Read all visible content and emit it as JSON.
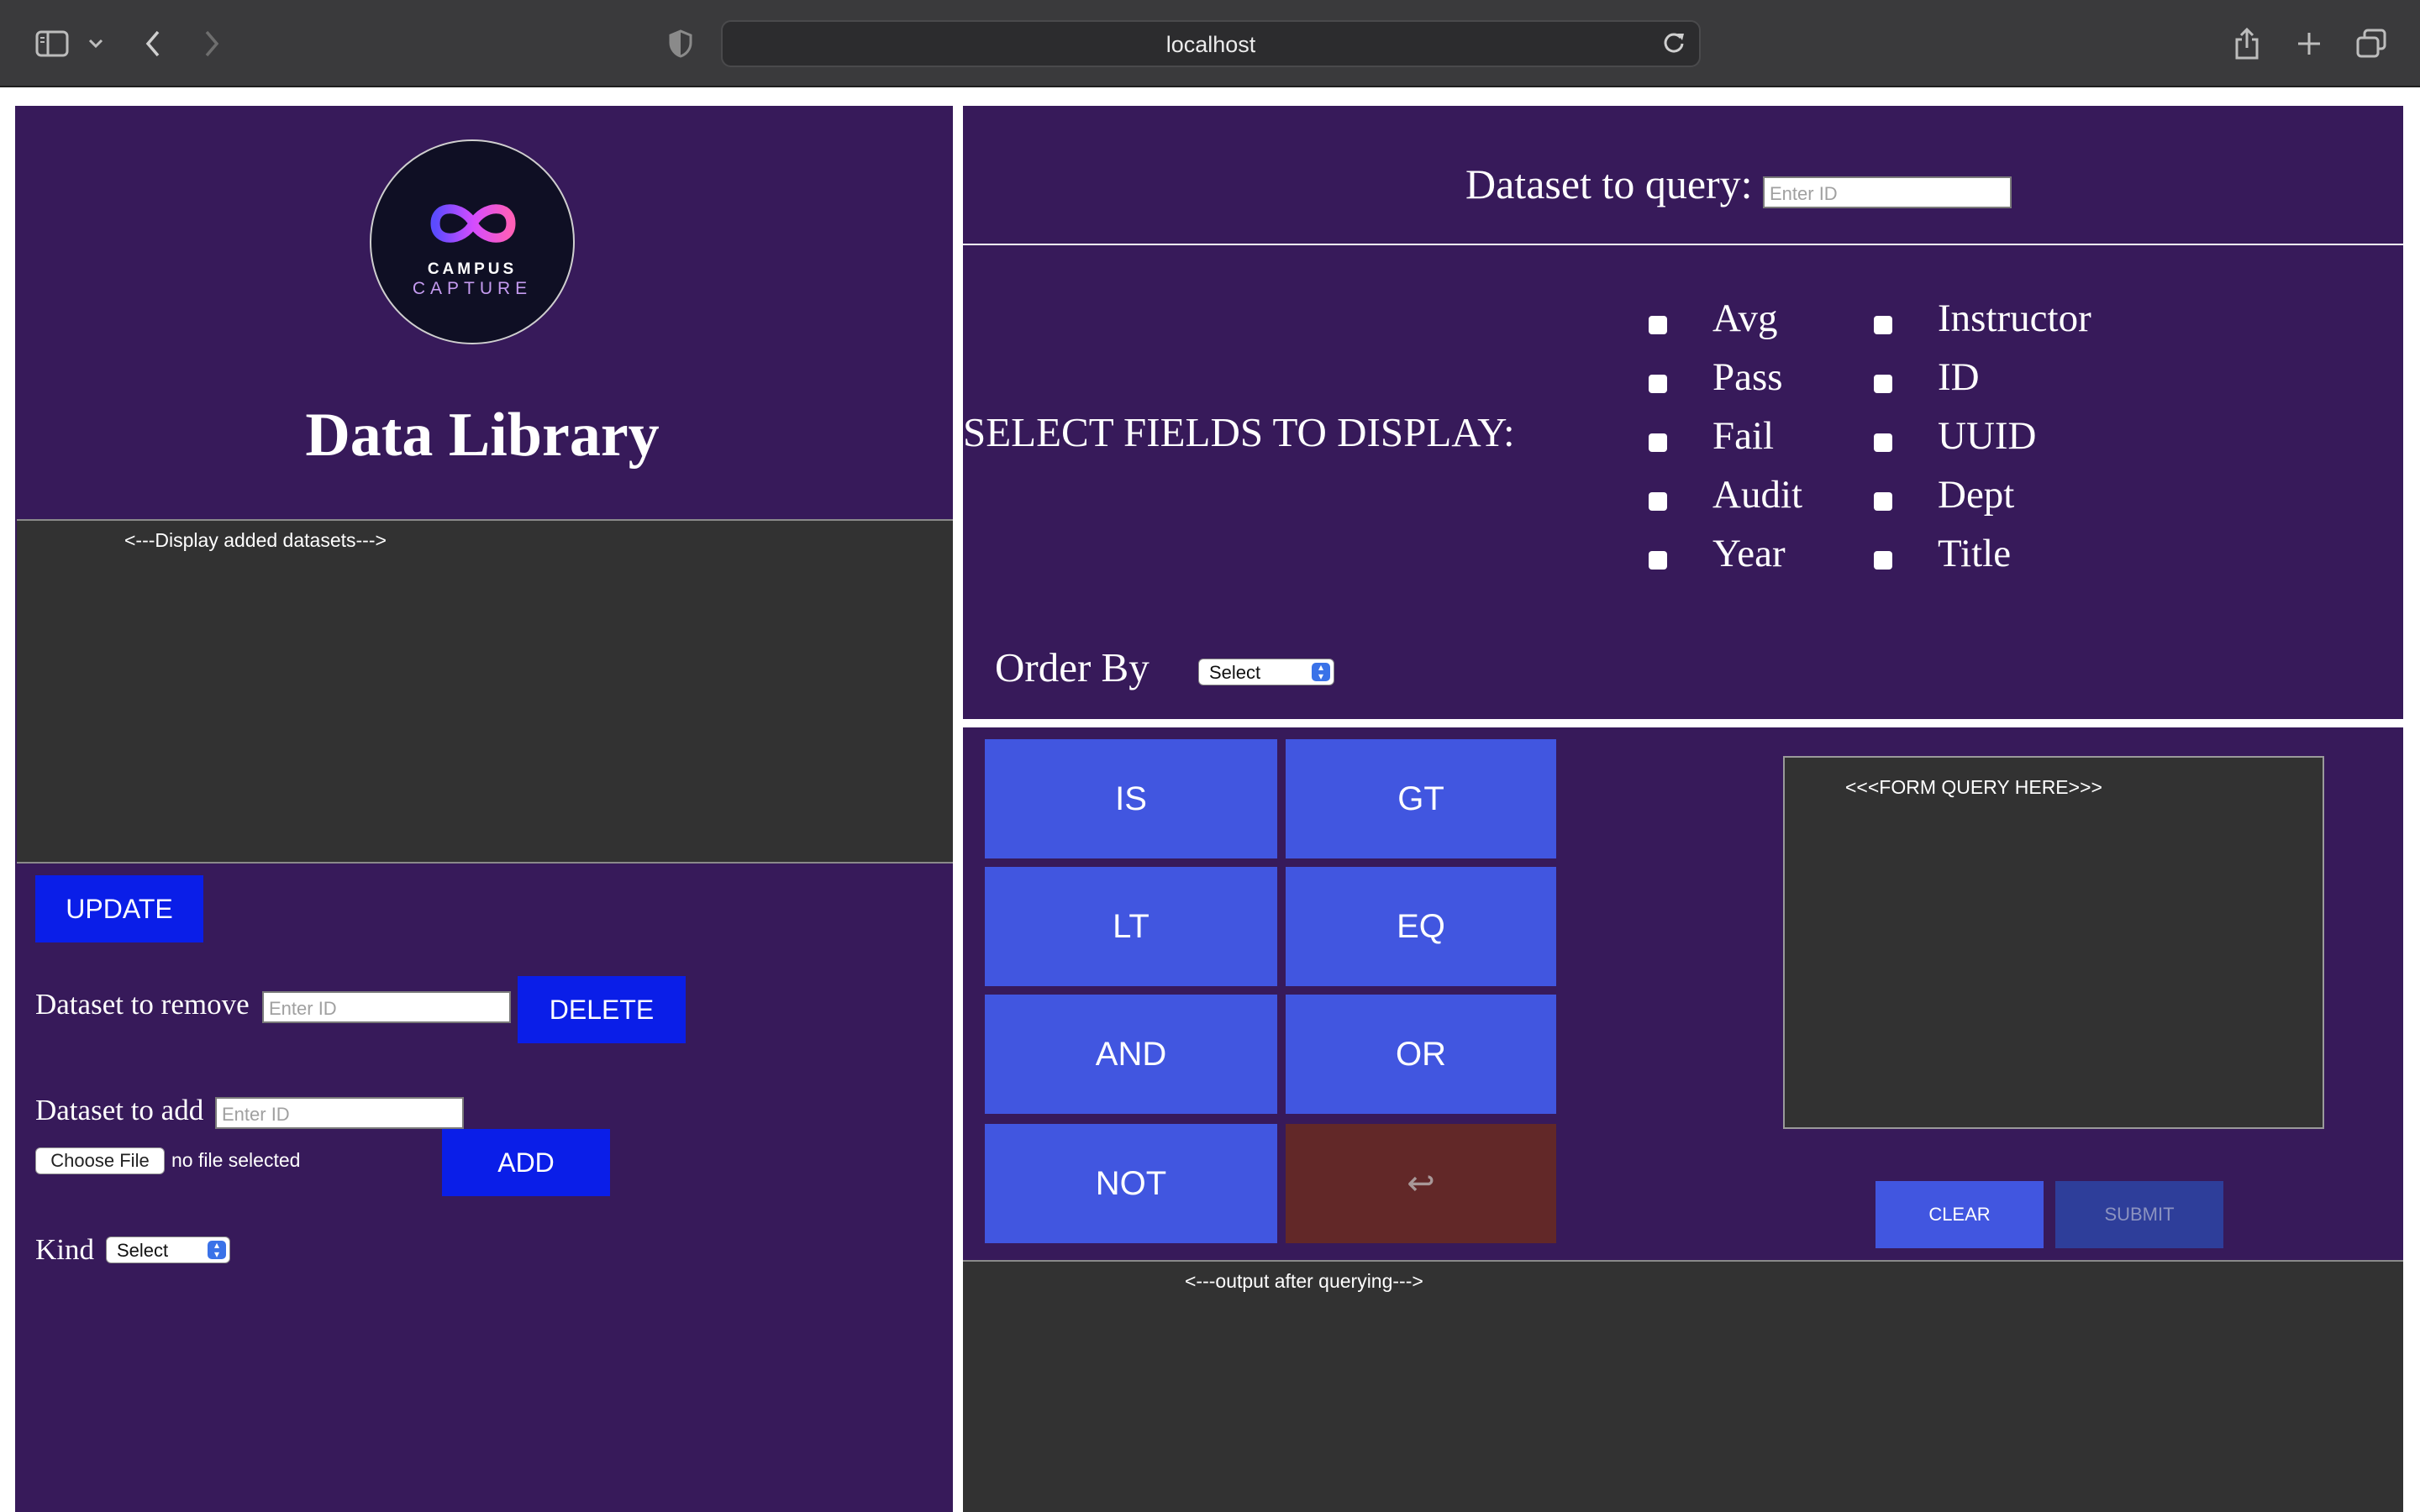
{
  "browser": {
    "url": "localhost"
  },
  "left": {
    "logo": {
      "line1": "CAMPUS",
      "line2": "CAPTURE"
    },
    "title": "Data Library",
    "datasets_placeholder": "<---Display added datasets--->",
    "update_label": "UPDATE",
    "remove_label": "Dataset to remove",
    "remove_placeholder": "Enter ID",
    "delete_label": "DELETE",
    "add_label": "Dataset to add",
    "add_placeholder": "Enter ID",
    "choose_file_label": "Choose File",
    "file_status": "no file selected",
    "add_button_label": "ADD",
    "kind_label": "Kind",
    "kind_value": "Select"
  },
  "right": {
    "query_label": "Dataset to query:",
    "query_placeholder": "Enter ID",
    "fields_title": "SELECT FIELDS TO DISPLAY:",
    "fields_col1": [
      "Avg",
      "Pass",
      "Fail",
      "Audit",
      "Year"
    ],
    "fields_col2": [
      "Instructor",
      "ID",
      "UUID",
      "Dept",
      "Title"
    ],
    "order_label": "Order By",
    "order_value": "Select",
    "operators": [
      "IS",
      "GT",
      "LT",
      "EQ",
      "AND",
      "OR",
      "NOT"
    ],
    "return_symbol": "↩",
    "query_box_placeholder": "<<<FORM QUERY HERE>>>",
    "clear_label": "CLEAR",
    "submit_label": "SUBMIT",
    "output_placeholder": "<---output after querying--->"
  },
  "colors": {
    "panel": "#371a5a",
    "dark_area": "#323232",
    "primary_button": "#0a1ee8",
    "operator_button": "#4156e0",
    "return_button": "#622828"
  }
}
